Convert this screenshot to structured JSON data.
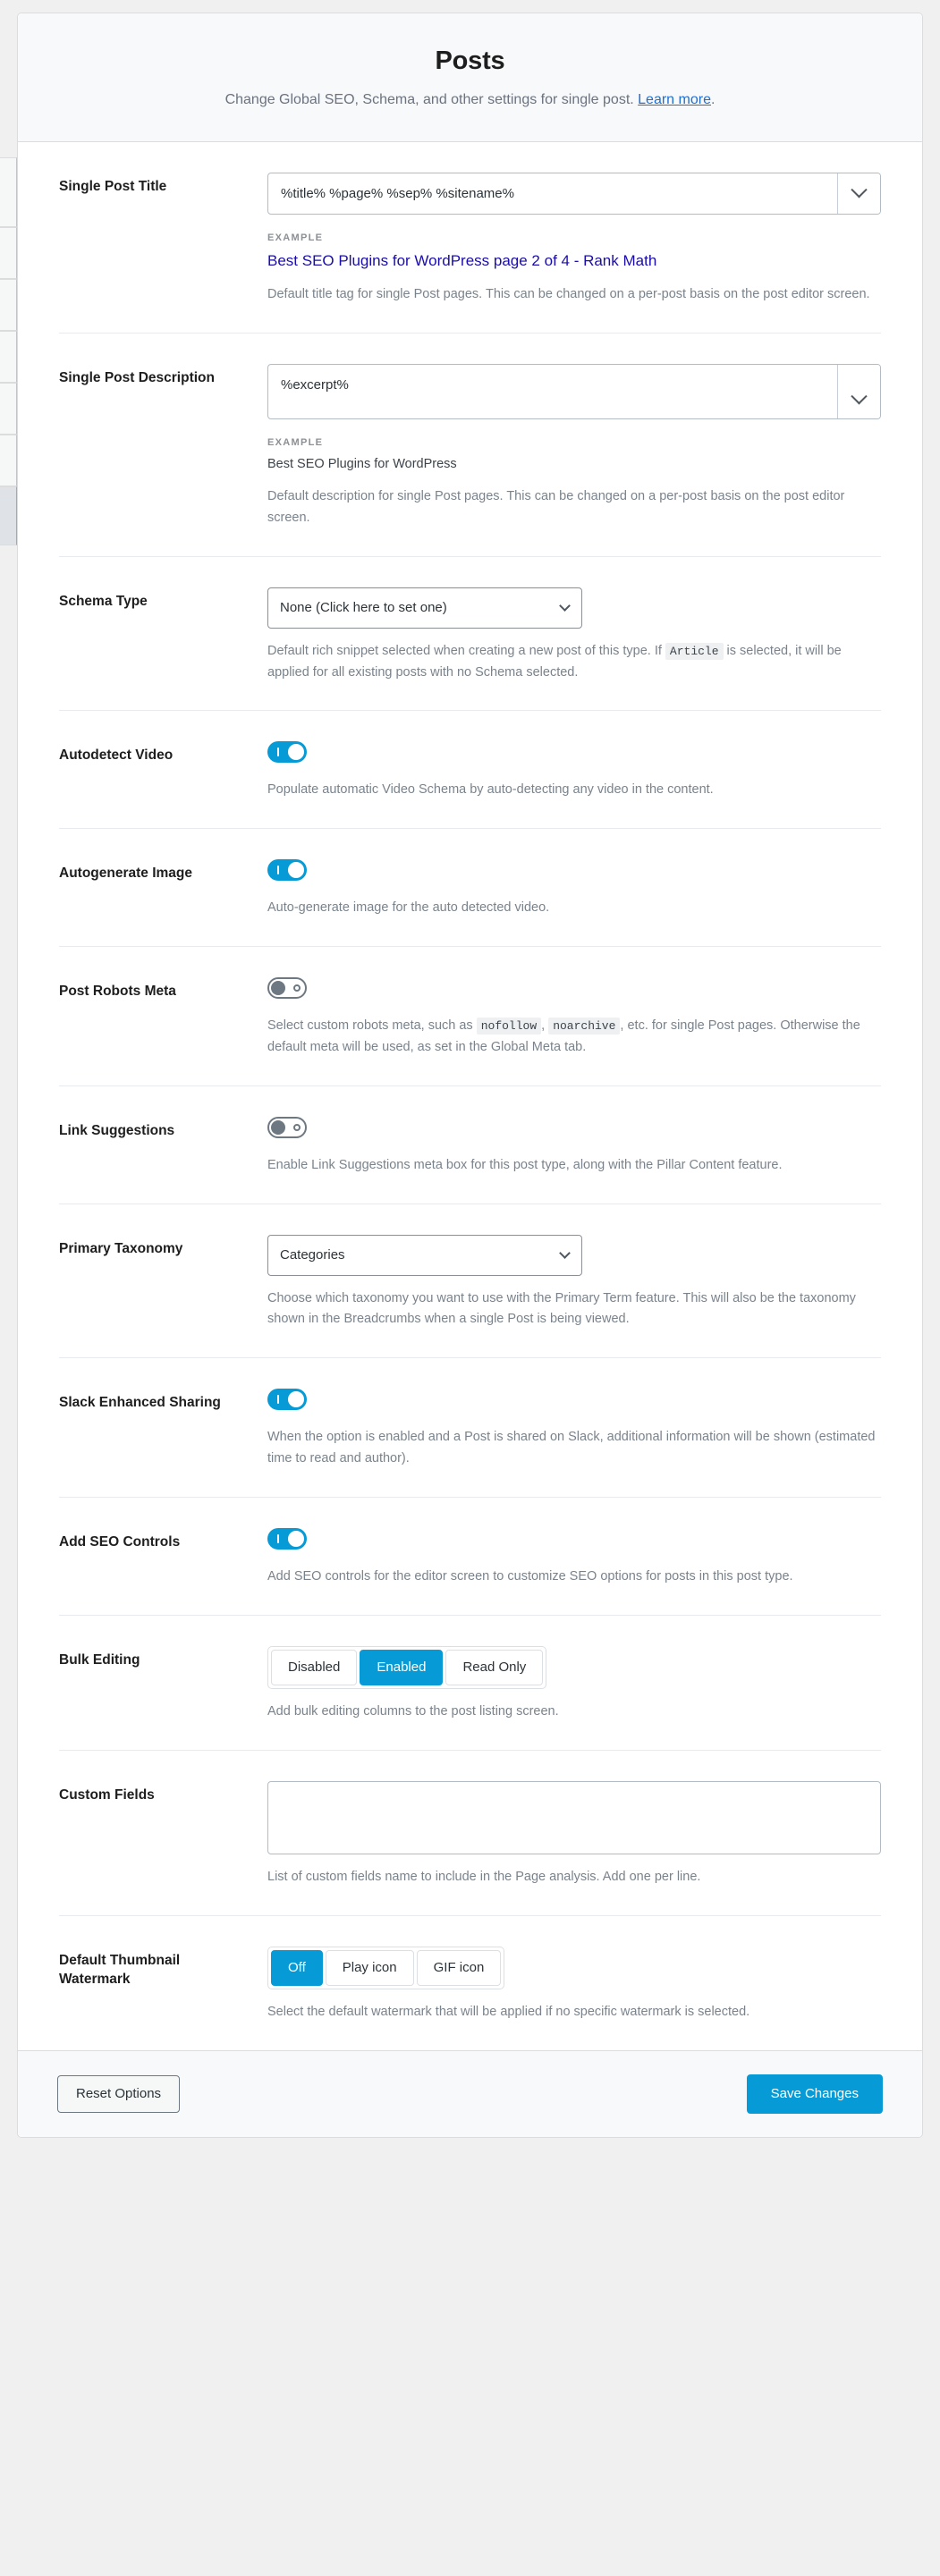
{
  "header": {
    "title": "Posts",
    "subtitle_before": "Change Global SEO, Schema, and other settings for single post. ",
    "learn_more": "Learn more",
    "subtitle_after": "."
  },
  "colors": {
    "accent": "#069bd6",
    "link": "#1f6fd0",
    "example_title": "#1a0dab",
    "muted_text": "#7a838c",
    "header_bg": "#f8f9fa",
    "toggle_off": "#6d7882"
  },
  "labels": {
    "example": "EXAMPLE"
  },
  "settings": [
    {
      "id": "single-post-title",
      "label": "Single Post Title",
      "type": "variable-text",
      "value": "%title% %page% %sep% %sitename%",
      "example_title": "Best SEO Plugins for WordPress page 2 of 4 - Rank Math",
      "help": "Default title tag for single Post pages. This can be changed on a per-post basis on the post editor screen."
    },
    {
      "id": "single-post-description",
      "label": "Single Post Description",
      "type": "variable-textarea",
      "value": "%excerpt%",
      "example_text": "Best SEO Plugins for WordPress",
      "help": "Default description for single Post pages. This can be changed on a per-post basis on the post editor screen."
    },
    {
      "id": "schema-type",
      "label": "Schema Type",
      "type": "select",
      "value": "None (Click here to set one)",
      "help_part1": "Default rich snippet selected when creating a new post of this type. If ",
      "help_code1": "Article",
      "help_part2": " is selected, it will be applied for all existing posts with no Schema selected."
    },
    {
      "id": "autodetect-video",
      "label": "Autodetect Video",
      "type": "toggle",
      "state": "on",
      "help": "Populate automatic Video Schema by auto-detecting any video in the content."
    },
    {
      "id": "autogenerate-image",
      "label": "Autogenerate Image",
      "type": "toggle",
      "state": "on",
      "help": "Auto-generate image for the auto detected video."
    },
    {
      "id": "post-robots-meta",
      "label": "Post Robots Meta",
      "type": "toggle",
      "state": "off",
      "help_part1": "Select custom robots meta, such as ",
      "help_code1": "nofollow",
      "help_sep": ", ",
      "help_code2": "noarchive",
      "help_part2": ", etc. for single Post pages. Otherwise the default meta will be used, as set in the Global Meta tab."
    },
    {
      "id": "link-suggestions",
      "label": "Link Suggestions",
      "type": "toggle",
      "state": "off",
      "help": "Enable Link Suggestions meta box for this post type, along with the Pillar Content feature."
    },
    {
      "id": "primary-taxonomy",
      "label": "Primary Taxonomy",
      "type": "select",
      "value": "Categories",
      "help": "Choose which taxonomy you want to use with the Primary Term feature. This will also be the taxonomy shown in the Breadcrumbs when a single Post is being viewed."
    },
    {
      "id": "slack-enhanced-sharing",
      "label": "Slack Enhanced Sharing",
      "type": "toggle",
      "state": "on",
      "help": "When the option is enabled and a Post is shared on Slack, additional information will be shown (estimated time to read and author)."
    },
    {
      "id": "add-seo-controls",
      "label": "Add SEO Controls",
      "type": "toggle",
      "state": "on",
      "help": "Add SEO controls for the editor screen to customize SEO options for posts in this post type."
    },
    {
      "id": "bulk-editing",
      "label": "Bulk Editing",
      "type": "segmented",
      "options": [
        "Disabled",
        "Enabled",
        "Read Only"
      ],
      "selected": "Enabled",
      "help": "Add bulk editing columns to the post listing screen."
    },
    {
      "id": "custom-fields",
      "label": "Custom Fields",
      "type": "textarea",
      "value": "",
      "help": "List of custom fields name to include in the Page analysis. Add one per line."
    },
    {
      "id": "default-thumbnail-watermark",
      "label": "Default Thumbnail Watermark",
      "type": "segmented",
      "options": [
        "Off",
        "Play icon",
        "GIF icon"
      ],
      "selected": "Off",
      "help": "Select the default watermark that will be applied if no specific watermark is selected."
    }
  ],
  "footer": {
    "reset_label": "Reset Options",
    "save_label": "Save Changes"
  }
}
